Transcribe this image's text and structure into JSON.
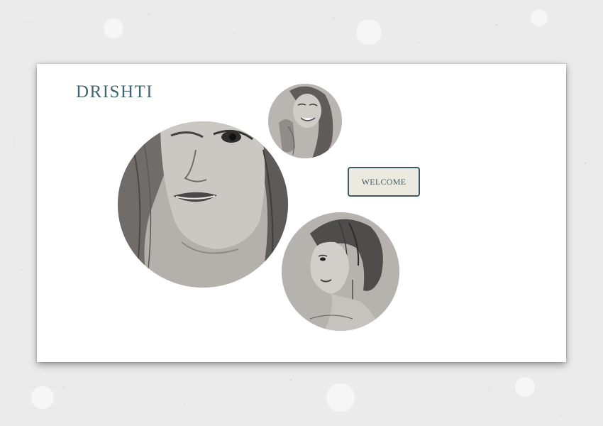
{
  "brand": {
    "name": "DRISHTI",
    "color": "#3f6570"
  },
  "hero": {
    "welcome_label": "WELCOME",
    "button_border_color": "#3d5a63",
    "button_fill_color": "#ebe9e0"
  },
  "gallery": {
    "items": [
      {
        "name": "sketch-portrait-closeup-face"
      },
      {
        "name": "sketch-portrait-smiling-girl"
      },
      {
        "name": "sketch-portrait-braided-woman"
      }
    ]
  },
  "colors": {
    "background": "#ececec",
    "card": "#ffffff",
    "sketch_paper": "#b5b2ae"
  }
}
